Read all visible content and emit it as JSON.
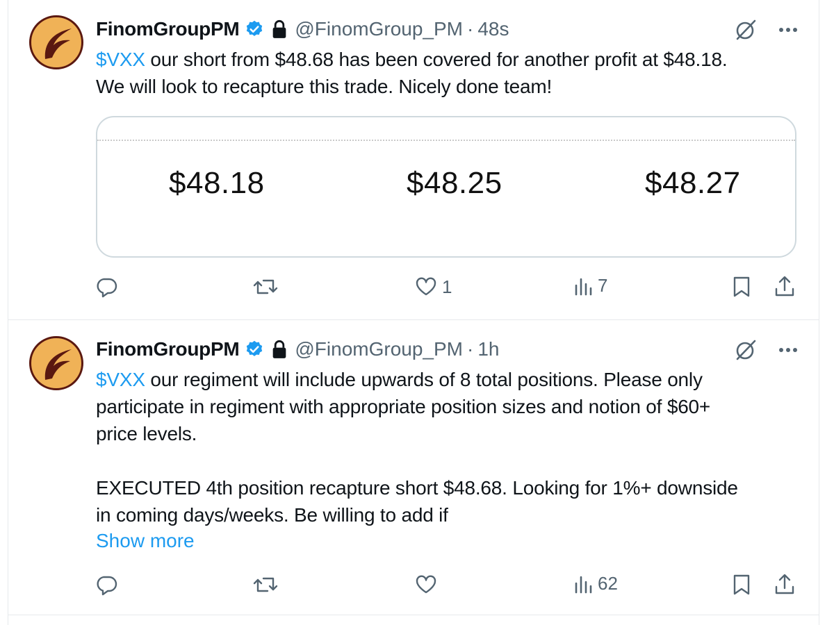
{
  "tweets": [
    {
      "name": "FinomGroupPM",
      "handle": "@FinomGroup_PM",
      "separator": "·",
      "time": "48s",
      "cashtag": "$VXX",
      "text_line1": " our short from $48.68 has been covered for another profit at $48.18.",
      "text_line2": "We will look to recapture this trade. Nicely done team!",
      "card_prices": [
        "$48.18",
        "$48.25",
        "$48.27"
      ],
      "likes": "1",
      "views": "7"
    },
    {
      "name": "FinomGroupPM",
      "handle": "@FinomGroup_PM",
      "separator": "·",
      "time": "1h",
      "cashtag": "$VXX",
      "para1_line1": " our regiment will include upwards of 8 total positions. Please only",
      "para1_line2": "participate in regiment with appropriate position sizes and notion of $60+",
      "para1_line3": "price levels.",
      "para2_line1": "EXECUTED 4th position recapture short $48.68. Looking for 1%+ downside",
      "para2_line2": "in coming days/weeks. Be willing to add if",
      "show_more": "Show more",
      "likes": "",
      "views": "62"
    }
  ],
  "colors": {
    "accent": "#1d9bf0",
    "muted": "#536471",
    "avatar_orange": "#f0b257",
    "avatar_brown": "#5a1810",
    "divider": "#e6e9ec"
  },
  "icons": {
    "verified": "verified-badge-icon",
    "lock": "lock-icon",
    "grok": "grok-icon",
    "more": "more-icon",
    "reply": "reply-icon",
    "retweet": "retweet-icon",
    "like": "heart-icon",
    "views": "views-icon",
    "bookmark": "bookmark-icon",
    "share": "share-icon"
  }
}
